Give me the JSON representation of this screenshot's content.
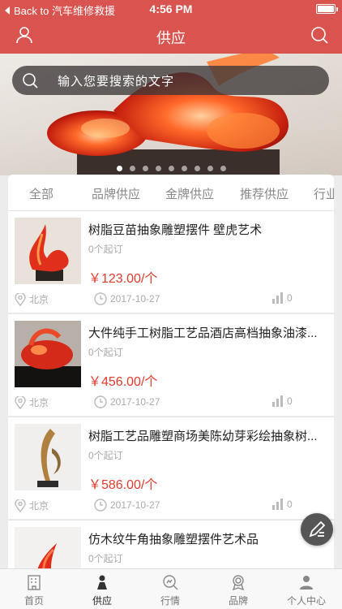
{
  "status_bar": {
    "back_label": "Back to 汽车维修救援",
    "time": "4:56 PM"
  },
  "nav": {
    "title": "供应",
    "left_icon": "user-icon",
    "right_icon": "search-icon"
  },
  "banner": {
    "search_placeholder": "输入您要搜索的文字",
    "page_count": 9,
    "active_page": 1
  },
  "tabs": [
    "全部",
    "品牌供应",
    "金牌供应",
    "推荐供应",
    "行业"
  ],
  "products": [
    {
      "title": "树脂豆苗抽象雕塑摆件 壁虎艺术",
      "moq": "0个起订",
      "price": "￥123.00/个",
      "location": "北京",
      "date": "2017-10-27",
      "views": "0"
    },
    {
      "title": "大件纯手工树脂工艺品酒店高档抽象油漆...",
      "moq": "0个起订",
      "price": "￥456.00/个",
      "location": "北京",
      "date": "2017-10-27",
      "views": "0"
    },
    {
      "title": "树脂工艺品雕塑商场美陈幼芽彩绘抽象树...",
      "moq": "0个起订",
      "price": "￥586.00/个",
      "location": "北京",
      "date": "2017-10-27",
      "views": "0"
    },
    {
      "title": "仿木纹牛角抽象雕塑摆件艺术品",
      "moq": "0个起订",
      "price": "",
      "location": "",
      "date": "",
      "views": ""
    }
  ],
  "tabbar": [
    {
      "label": "首页",
      "icon": "building-icon"
    },
    {
      "label": "供应",
      "icon": "person-icon",
      "active": true
    },
    {
      "label": "行情",
      "icon": "chart-icon"
    },
    {
      "label": "品牌",
      "icon": "badge-icon"
    },
    {
      "label": "个人中心",
      "icon": "profile-icon"
    }
  ],
  "colors": {
    "brand": "#d9534f",
    "price": "#e23b2e"
  }
}
